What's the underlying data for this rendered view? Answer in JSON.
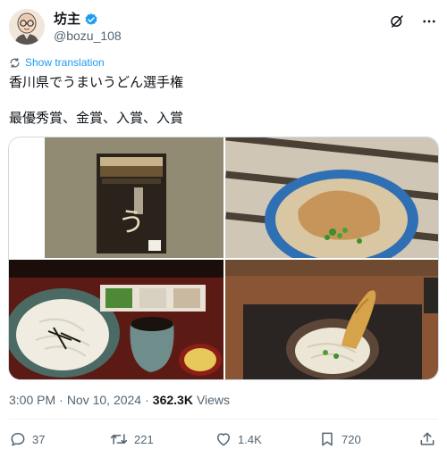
{
  "author": {
    "display_name": "坊主",
    "handle": "@bozu_108",
    "verified": true
  },
  "translate_label": "Show translation",
  "text_lines": [
    "香川県でうまいうどん選手権",
    "最優秀賞、金賞、入賞、入賞"
  ],
  "media": [
    {
      "label": "udon box package"
    },
    {
      "label": "kitsune udon bowl"
    },
    {
      "label": "zaru udon set"
    },
    {
      "label": "tempura udon bowl"
    }
  ],
  "meta": {
    "time": "3:00 PM",
    "separator": "·",
    "date": "Nov 10, 2024",
    "views_count": "362.3K",
    "views_label": "Views"
  },
  "actions": {
    "replies": "37",
    "reposts": "221",
    "likes": "1.4K",
    "bookmarks": "720"
  },
  "colors": {
    "accent": "#1d9bf0",
    "secondary_text": "#536471",
    "primary_text": "#0f1419"
  }
}
